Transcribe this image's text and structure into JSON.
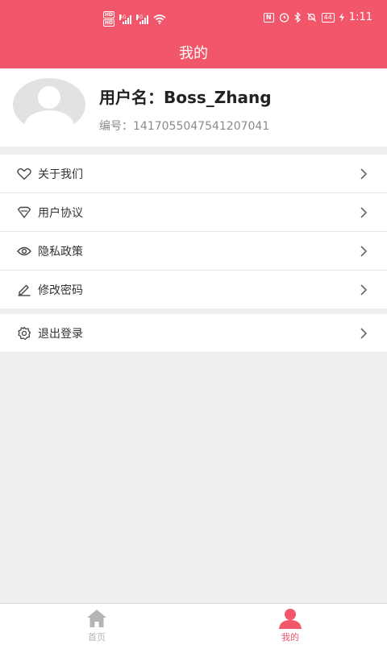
{
  "status_bar": {
    "hd1": "HD",
    "hd2": "HD",
    "net1": "4G",
    "net2": "4G",
    "nfc": "N",
    "battery": "44",
    "time": "1:11"
  },
  "header": {
    "title": "我的"
  },
  "profile": {
    "username": "用户名：Boss_Zhang",
    "user_id": "编号：1417055047541207041"
  },
  "menu": {
    "group1": [
      {
        "label": "关于我们",
        "icon": "heart-icon"
      },
      {
        "label": "用户协议",
        "icon": "diamond-icon"
      },
      {
        "label": "隐私政策",
        "icon": "eye-icon"
      },
      {
        "label": "修改密码",
        "icon": "edit-icon"
      }
    ],
    "group2": [
      {
        "label": "退出登录",
        "icon": "settings-icon"
      }
    ]
  },
  "bottom_nav": {
    "tabs": [
      {
        "label": "首页",
        "icon": "home-icon",
        "active": false
      },
      {
        "label": "我的",
        "icon": "user-icon",
        "active": true
      }
    ]
  },
  "colors": {
    "brand": "#f2566a",
    "inactive_tab": "#b5b5b5",
    "background": "#eeeeee"
  }
}
